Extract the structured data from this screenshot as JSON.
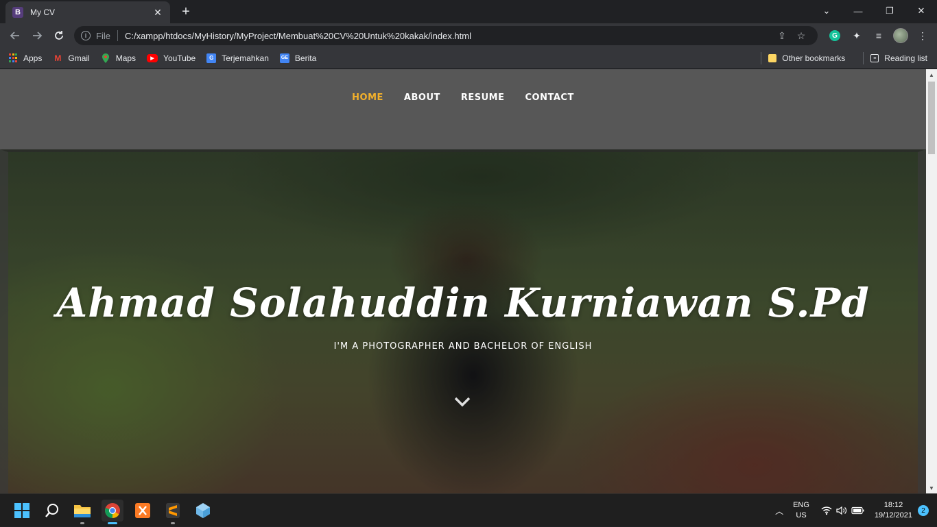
{
  "browser": {
    "tab": {
      "favicon_letter": "B",
      "title": "My CV",
      "close": "✕"
    },
    "new_tab": "+",
    "window_controls": [
      "⌄",
      "—",
      "❐",
      "✕"
    ],
    "address": {
      "scheme_label": "File",
      "url": "C:/xampp/htdocs/MyHistory/MyProject/Membuat%20CV%20Untuk%20kakak/index.html"
    },
    "bookmarks": [
      {
        "label": "Apps",
        "icon": "apps-grid-icon"
      },
      {
        "label": "Gmail",
        "icon": "gmail-icon"
      },
      {
        "label": "Maps",
        "icon": "maps-pin-icon"
      },
      {
        "label": "YouTube",
        "icon": "youtube-icon"
      },
      {
        "label": "Terjemahkan",
        "icon": "translate-icon"
      },
      {
        "label": "Berita",
        "icon": "news-icon"
      }
    ],
    "other_bookmarks": "Other bookmarks",
    "reading_list": "Reading list"
  },
  "site": {
    "nav": [
      {
        "label": "HOME",
        "active": true
      },
      {
        "label": "ABOUT",
        "active": false
      },
      {
        "label": "RESUME",
        "active": false
      },
      {
        "label": "CONTACT",
        "active": false
      }
    ],
    "hero": {
      "name": "Ahmad Solahuddin Kurniawan S.Pd",
      "tagline": "I'M A PHOTOGRAPHER AND BACHELOR OF ENGLISH"
    },
    "colors": {
      "accent": "#f2b02b",
      "nav_bg": "#575757"
    }
  },
  "taskbar": {
    "apps": [
      "start-icon",
      "search-icon",
      "file-explorer-icon",
      "chrome-icon",
      "xampp-icon",
      "sublime-text-icon",
      "3d-viewer-icon"
    ],
    "lang_top": "ENG",
    "lang_bottom": "US",
    "time": "18:12",
    "date": "19/12/2021",
    "notifications": "2"
  }
}
